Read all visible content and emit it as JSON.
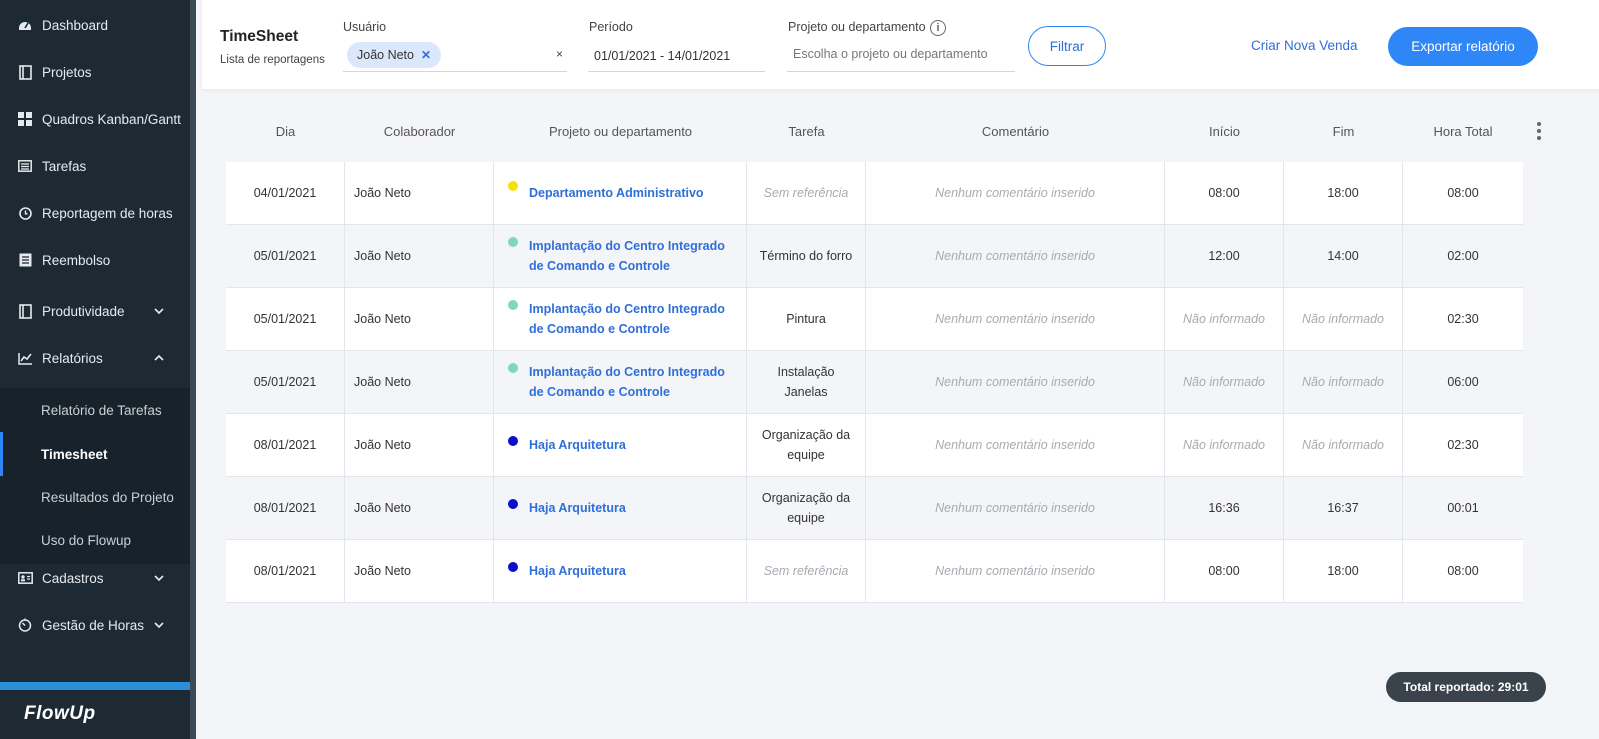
{
  "sidebar": {
    "items": [
      {
        "label": "Dashboard",
        "icon": "dashboard-icon"
      },
      {
        "label": "Projetos",
        "icon": "book-icon"
      },
      {
        "label": "Quadros Kanban/Gantt",
        "icon": "grid-icon"
      },
      {
        "label": "Tarefas",
        "icon": "list-icon"
      },
      {
        "label": "Reportagem de horas",
        "icon": "clock-icon"
      },
      {
        "label": "Reembolso",
        "icon": "document-icon"
      },
      {
        "label": "Produtividade",
        "icon": "book-icon"
      },
      {
        "label": "Relatórios",
        "icon": "chart-line-icon"
      },
      {
        "label": "Cadastros",
        "icon": "id-card-icon"
      },
      {
        "label": "Gestão de Horas",
        "icon": "timer-icon"
      }
    ],
    "submenu": [
      {
        "label": "Relatório de Tarefas"
      },
      {
        "label": "Timesheet"
      },
      {
        "label": "Resultados do Projeto"
      },
      {
        "label": "Uso do Flowup"
      }
    ],
    "logo": "FlowUp"
  },
  "header": {
    "title": "TimeSheet",
    "subtitle": "Lista de reportagens",
    "user_label": "Usuário",
    "user_chip": "João Neto",
    "chip_remove": "✕",
    "clear": "×",
    "period_label": "Período",
    "period_value": "01/01/2021 - 14/01/2021",
    "project_label": "Projeto ou departamento",
    "project_placeholder": "Escolha o projeto ou departamento",
    "filter_button": "Filtrar",
    "new_sale": "Criar Nova Venda",
    "export_button": "Exportar relatório"
  },
  "table": {
    "columns": [
      "Dia",
      "Colaborador",
      "Projeto ou departamento",
      "Tarefa",
      "Comentário",
      "Início",
      "Fim",
      "Hora Total"
    ],
    "rows": [
      {
        "dia": "04/01/2021",
        "colaborador": "João Neto",
        "projeto": "Departamento Administrativo",
        "dot_color": "#f5e10a",
        "tarefa": "Sem referência",
        "comentario": "Nenhum comentário inserido",
        "inicio": "08:00",
        "fim": "18:00",
        "total": "08:00"
      },
      {
        "dia": "05/01/2021",
        "colaborador": "João Neto",
        "projeto": "Implantação do Centro Integrado de Comando e Controle",
        "dot_color": "#7fd8bd",
        "tarefa": "Término do forro",
        "comentario": "Nenhum comentário inserido",
        "inicio": "12:00",
        "fim": "14:00",
        "total": "02:00"
      },
      {
        "dia": "05/01/2021",
        "colaborador": "João Neto",
        "projeto": "Implantação do Centro Integrado de Comando e Controle",
        "dot_color": "#7fd8bd",
        "tarefa": "Pintura",
        "comentario": "Nenhum comentário inserido",
        "inicio": "Não informado",
        "fim": "Não informado",
        "total": "02:30"
      },
      {
        "dia": "05/01/2021",
        "colaborador": "João Neto",
        "projeto": "Implantação do Centro Integrado de Comando e Controle",
        "dot_color": "#7fd8bd",
        "tarefa": "Instalação Janelas",
        "comentario": "Nenhum comentário inserido",
        "inicio": "Não informado",
        "fim": "Não informado",
        "total": "06:00"
      },
      {
        "dia": "08/01/2021",
        "colaborador": "João Neto",
        "projeto": "Haja Arquitetura",
        "dot_color": "#0a10c8",
        "tarefa": "Organização da equipe",
        "comentario": "Nenhum comentário inserido",
        "inicio": "Não informado",
        "fim": "Não informado",
        "total": "02:30"
      },
      {
        "dia": "08/01/2021",
        "colaborador": "João Neto",
        "projeto": "Haja Arquitetura",
        "dot_color": "#0a10c8",
        "tarefa": "Organização da equipe",
        "comentario": "Nenhum comentário inserido",
        "inicio": "16:36",
        "fim": "16:37",
        "total": "00:01"
      },
      {
        "dia": "08/01/2021",
        "colaborador": "João Neto",
        "projeto": "Haja Arquitetura",
        "dot_color": "#0a10c8",
        "tarefa": "Sem referência",
        "comentario": "Nenhum comentário inserido",
        "inicio": "08:00",
        "fim": "18:00",
        "total": "08:00"
      }
    ]
  },
  "total_reported": "Total reportado: 29:01",
  "colors": {
    "accent": "#2f86f6",
    "sidebar": "#1e2a33",
    "link": "#2f6fd8"
  }
}
